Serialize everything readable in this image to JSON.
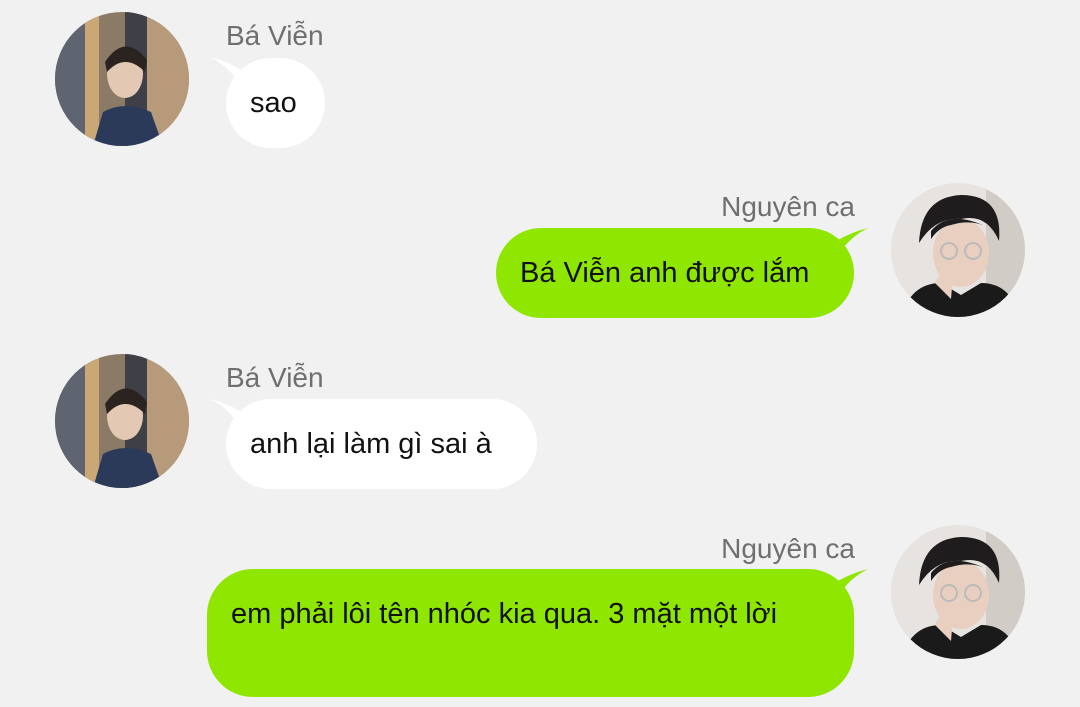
{
  "colors": {
    "background": "#f1f1f1",
    "incoming_bubble": "#ffffff",
    "outgoing_bubble": "#8fe600",
    "name_text": "#6f6f6f",
    "message_text": "#111111"
  },
  "messages": [
    {
      "sender": "Bá Viễn",
      "direction": "incoming",
      "avatar": "avatar-ba-vien",
      "text": "sao"
    },
    {
      "sender": "Nguyên ca",
      "direction": "outgoing",
      "avatar": "avatar-nguyen-ca",
      "text": "Bá Viễn anh được lắm"
    },
    {
      "sender": "Bá Viễn",
      "direction": "incoming",
      "avatar": "avatar-ba-vien",
      "text": "anh lại làm gì sai à"
    },
    {
      "sender": "Nguyên ca",
      "direction": "outgoing",
      "avatar": "avatar-nguyen-ca",
      "text": "em phải lôi tên nhóc kia qua. 3 mặt một lời"
    }
  ]
}
